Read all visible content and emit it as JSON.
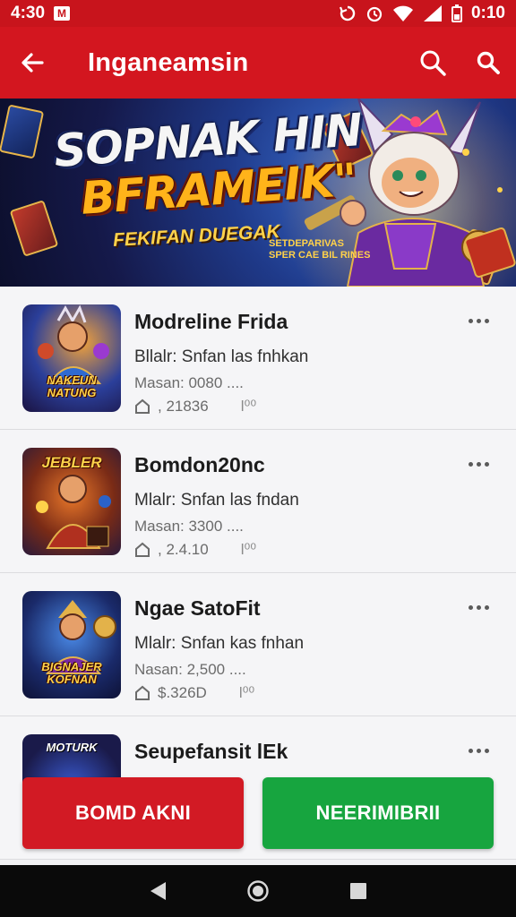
{
  "status_bar": {
    "time": "4:30",
    "clock": "0:10",
    "notification_icon": "gmail-icon",
    "icons": [
      "sync-icon",
      "alarm-icon",
      "wifi-icon",
      "signal-icon",
      "battery-icon"
    ]
  },
  "app_bar": {
    "title": "Inganeamsin",
    "back_icon": "back-arrow-icon",
    "actions": [
      "search-icon",
      "search-icon"
    ]
  },
  "banner": {
    "headline_line1": "SOPNAK HIN",
    "headline_line2": "BFRAMEIK\"",
    "tagline": "FEKIFAN DUEGAK",
    "small_text_line1": "SETDEPARIVAS",
    "small_text_line2": "SPER CAE BIL RINES"
  },
  "items": [
    {
      "name": "Modreline Frida",
      "description": "Bllalr: Snfan las fnhkan",
      "meta": "Masan: 0080 ....",
      "stat_value": ", 21836",
      "stat_extra": "l⁰⁰",
      "thumb_text": "NAKEUN NATUNG",
      "thumb_colors": [
        "#e98a1f",
        "#2b3f9a",
        "#5a1f6a"
      ]
    },
    {
      "name": "Bomdon20nc",
      "description": "Mlalr: Snfan las fndan",
      "meta": "Masan: 3300 ....",
      "stat_value": ", 2.4.10",
      "stat_extra": "l⁰⁰",
      "thumb_text": "JEBLER",
      "thumb_colors": [
        "#d0541c",
        "#2a1a3a",
        "#7a2b16"
      ]
    },
    {
      "name": "Ngae SatoFit",
      "description": "Mlalr: Snfan kas fnhan",
      "meta": "Nasan: 2,500 ....",
      "stat_value": "$.326D",
      "stat_extra": "l⁰⁰",
      "thumb_text": "BIGNAJER KOFNAN",
      "thumb_colors": [
        "#2b62c8",
        "#1a2a6a",
        "#e0a020"
      ]
    },
    {
      "name": "Seupefansit lEk",
      "description": "",
      "meta": "",
      "stat_value": "",
      "stat_extra": "",
      "thumb_text": "MOTURK",
      "thumb_colors": [
        "#2b3f9a",
        "#c03a2b",
        "#1a1a4a"
      ]
    }
  ],
  "buttons": {
    "primary_label": "BOMD AKNI",
    "secondary_label": "NEERIMIBRII"
  },
  "nav_bar": {
    "icons": [
      "back-triangle-icon",
      "home-circle-icon",
      "recents-square-icon"
    ]
  },
  "colors": {
    "brand_red": "#d3161f",
    "status_red": "#c8141c",
    "button_red": "#d21a24",
    "button_green": "#17a53f"
  }
}
